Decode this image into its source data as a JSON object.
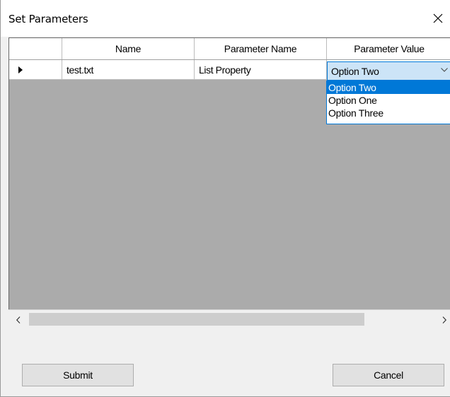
{
  "window": {
    "title": "Set Parameters"
  },
  "grid": {
    "columns": [
      "Name",
      "Parameter Name",
      "Parameter Value"
    ],
    "rows": [
      {
        "name": "test.txt",
        "parameter_name": "List Property",
        "parameter_value": "Option Two"
      }
    ]
  },
  "dropdown": {
    "selected": "Option Two",
    "options": [
      "Option Two",
      "Option One",
      "Option Three"
    ]
  },
  "buttons": {
    "submit": "Submit",
    "cancel": "Cancel"
  },
  "colors": {
    "accent": "#0078d7",
    "grid_background": "#ababab",
    "combo_background": "#cce4f7"
  }
}
